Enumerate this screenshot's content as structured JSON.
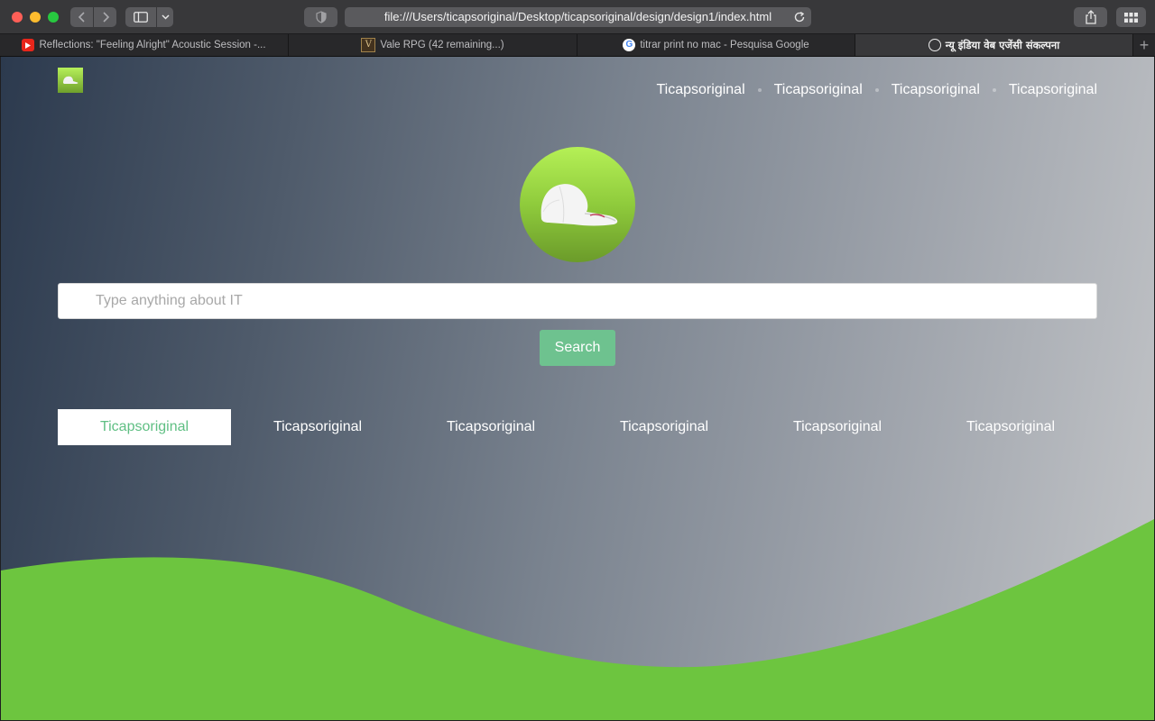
{
  "browser": {
    "url": "file:///Users/ticapsoriginal/Desktop/ticapsoriginal/design/design1/index.html",
    "tabs": [
      {
        "title": "Reflections: \"Feeling Alright\" Acoustic Session -...",
        "icon": "youtube-icon"
      },
      {
        "title": "Vale RPG (42 remaining...)",
        "icon": "vale-rpg-icon"
      },
      {
        "title": "titrar print no mac - Pesquisa Google",
        "icon": "google-icon"
      },
      {
        "title": "न्यू इंडिया वेब एजेंसी संकल्पना",
        "icon": "compass-icon",
        "active": true
      }
    ],
    "new_tab_label": "+"
  },
  "page": {
    "nav": [
      "Ticapsoriginal",
      "Ticapsoriginal",
      "Ticapsoriginal",
      "Ticapsoriginal"
    ],
    "search": {
      "placeholder": "Type anything about IT",
      "value": "",
      "button_label": "Search"
    },
    "category_tabs": [
      {
        "label": "Ticapsoriginal",
        "active": true
      },
      {
        "label": "Ticapsoriginal",
        "active": false
      },
      {
        "label": "Ticapsoriginal",
        "active": false
      },
      {
        "label": "Ticapsoriginal",
        "active": false
      },
      {
        "label": "Ticapsoriginal",
        "active": false
      },
      {
        "label": "Ticapsoriginal",
        "active": false
      }
    ],
    "logo_icon": "baseball-cap-icon"
  },
  "colors": {
    "accent_green": "#6ec28f",
    "wave_green": "#6dc53f",
    "active_tab_text": "#5fbf83",
    "gradient_dark": "#2c3a4e",
    "gradient_light": "#c3c5c8"
  }
}
